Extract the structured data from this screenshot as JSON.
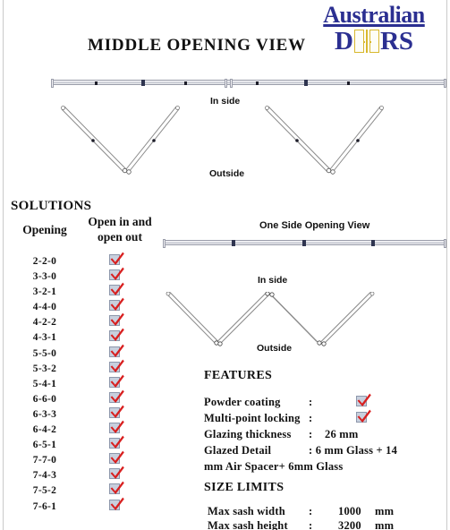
{
  "logo": {
    "word": "Australian",
    "letters": [
      "D",
      "Я",
      "S"
    ],
    "door_icon": "door-icon",
    "color": "#2b2f91",
    "door_color": "#d8b82e"
  },
  "titles": {
    "middle_opening": "MIDDLE OPENING VIEW",
    "one_side_opening": "One Side Opening View"
  },
  "labels": {
    "in_side_top": "In side",
    "outside_top": "Outside",
    "in_side_bottom": "In side",
    "outside_bottom": "Outside"
  },
  "solutions": {
    "heading": "SOLUTIONS",
    "columns": [
      "Opening",
      "Open in and open out"
    ],
    "column_opening": "Opening",
    "column_openinout_line1": "Open in and",
    "column_openinout_line2": "open out",
    "rows": [
      {
        "opening": "2-2-0",
        "open_in_and_out": true
      },
      {
        "opening": "3-3-0",
        "open_in_and_out": true
      },
      {
        "opening": "3-2-1",
        "open_in_and_out": true
      },
      {
        "opening": "4-4-0",
        "open_in_and_out": true
      },
      {
        "opening": "4-2-2",
        "open_in_and_out": true
      },
      {
        "opening": "4-3-1",
        "open_in_and_out": true
      },
      {
        "opening": "5-5-0",
        "open_in_and_out": true
      },
      {
        "opening": "5-3-2",
        "open_in_and_out": true
      },
      {
        "opening": "5-4-1",
        "open_in_and_out": true
      },
      {
        "opening": "6-6-0",
        "open_in_and_out": true
      },
      {
        "opening": "6-3-3",
        "open_in_and_out": true
      },
      {
        "opening": "6-4-2",
        "open_in_and_out": true
      },
      {
        "opening": "6-5-1",
        "open_in_and_out": true
      },
      {
        "opening": "7-7-0",
        "open_in_and_out": true
      },
      {
        "opening": "7-4-3",
        "open_in_and_out": true
      },
      {
        "opening": "7-5-2",
        "open_in_and_out": true
      },
      {
        "opening": "7-6-1",
        "open_in_and_out": true
      }
    ]
  },
  "features": {
    "heading": "FEATURES",
    "powder_coating": {
      "label": "Powder coating",
      "colon": ":",
      "checked": true
    },
    "multi_point_locking": {
      "label": "Multi-point locking",
      "colon": ":",
      "checked": true
    },
    "glazing_thickness": {
      "label": "Glazing thickness",
      "colon": ":",
      "value": "26 mm"
    },
    "glazed_detail": {
      "label": "Glazed Detail",
      "value_line1": ": 6 mm Glass + 14",
      "value_line2": "mm Air Spacer+ 6mm Glass"
    }
  },
  "size_limits": {
    "heading": "SIZE LIMITS",
    "max_sash_width": {
      "label": "Max sash width",
      "colon": ":",
      "value": "1000",
      "unit": "mm"
    },
    "max_sash_height": {
      "label": "Max sash height",
      "colon": ":",
      "value": "3200",
      "unit": "mm"
    }
  },
  "colors": {
    "check_red": "#d82020",
    "rail_gray": "#b9bcc6",
    "logo_blue": "#2b2f91"
  }
}
